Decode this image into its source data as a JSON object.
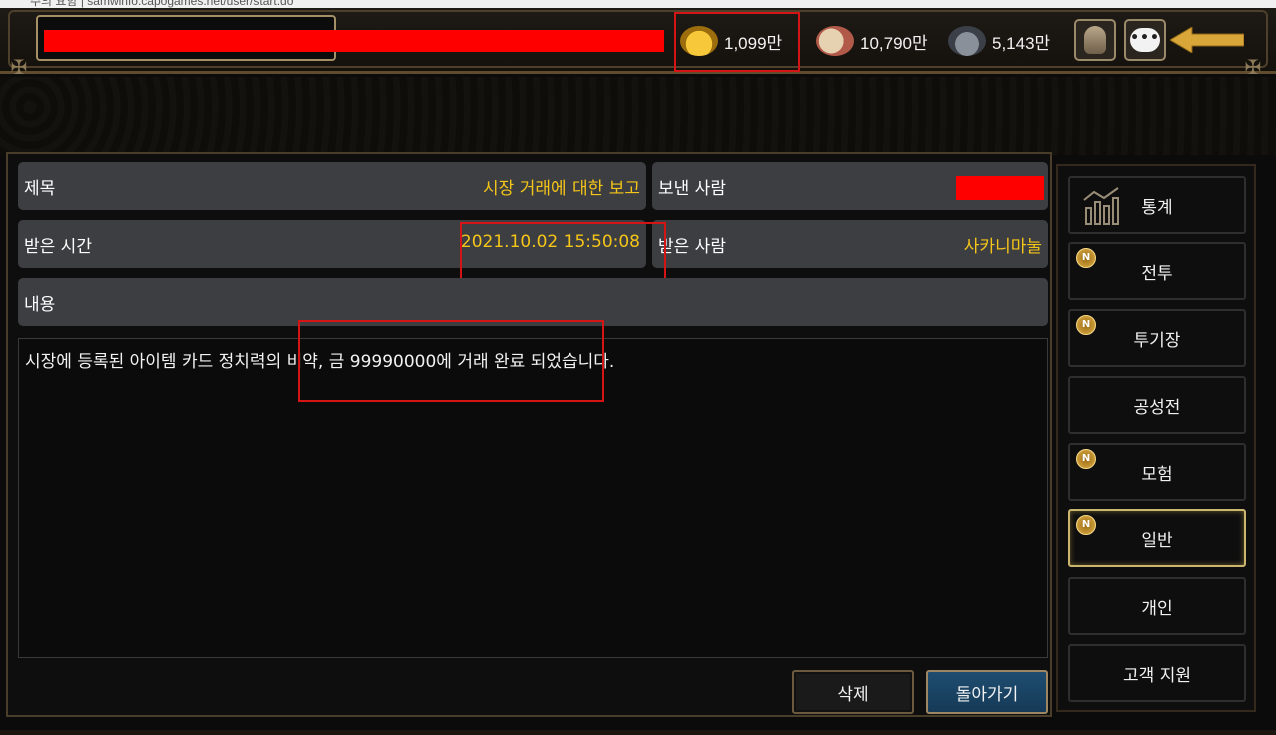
{
  "browser": {
    "url_text": "주의 요함  |  samwinfo.capogames.net/user/start.do"
  },
  "header": {
    "resources": [
      {
        "icon": "gold-ingot-icon",
        "value": "1,099만"
      },
      {
        "icon": "food-icon",
        "value": "10,790만"
      },
      {
        "icon": "ore-icon",
        "value": "5,143만"
      }
    ],
    "chat_glyph": "•••"
  },
  "mail": {
    "subject_label": "제목",
    "subject_value": "시장 거래에 대한 보고",
    "sender_label": "보낸 사람",
    "received_label": "받은 시간",
    "received_value": "2021.10.02 15:50:08",
    "recipient_label": "받은 사람",
    "recipient_value": "사카니마눌",
    "content_label": "내용",
    "body": "시장에 등록된 아이템 카드 정치력의 비약, 금 99990000에 거래 완료 되었습니다."
  },
  "buttons": {
    "delete": "삭제",
    "back": "돌아가기"
  },
  "side_menu": [
    {
      "label": "통계",
      "badge": "",
      "active": false
    },
    {
      "label": "전투",
      "badge": "N",
      "active": false
    },
    {
      "label": "투기장",
      "badge": "N",
      "active": false
    },
    {
      "label": "공성전",
      "badge": "",
      "active": false
    },
    {
      "label": "모험",
      "badge": "N",
      "active": false
    },
    {
      "label": "일반",
      "badge": "N",
      "active": true
    },
    {
      "label": "개인",
      "badge": "",
      "active": false
    },
    {
      "label": "고객 지원",
      "badge": "",
      "active": false
    }
  ],
  "colors": {
    "accent_gold": "#f5c518",
    "highlight_red": "#d51515",
    "redaction": "#ff0000"
  }
}
